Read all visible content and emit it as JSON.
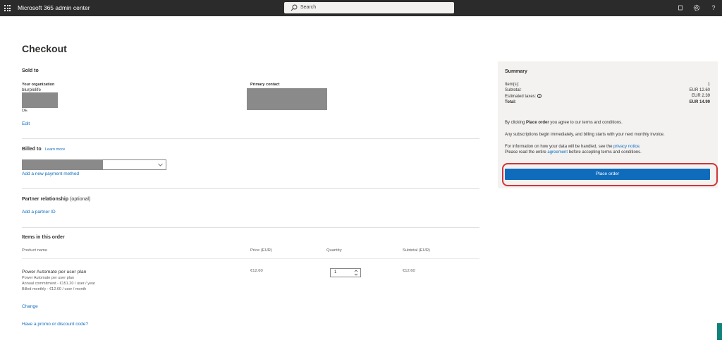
{
  "topbar": {
    "app_title": "Microsoft 365 admin center",
    "search_placeholder": "Search",
    "icons": [
      "waffle-icon",
      "search-icon",
      "dialog-icon",
      "settings-icon",
      "help-icon"
    ],
    "help_glyph": "?"
  },
  "page": {
    "title": "Checkout"
  },
  "sold_to": {
    "title": "Sold to",
    "org_label": "Your organization",
    "org_name": "blurplelife",
    "country": "DE",
    "primary_contact_label": "Primary contact",
    "edit_link": "Edit"
  },
  "billed_to": {
    "title": "Billed to",
    "learn_more": "Learn more",
    "add_payment": "Add a new payment method"
  },
  "partner": {
    "title": "Partner relationship",
    "optional": "(optional)",
    "add_partner": "Add a partner ID"
  },
  "items": {
    "title": "Items in this order",
    "columns": [
      "Product name",
      "Price (EUR)",
      "Quantity",
      "Subtotal (EUR)"
    ],
    "rows": [
      {
        "name": "Power Automate per user plan",
        "detail1": "Power Automate per user plan",
        "detail2": "Annual commitment - €151.20 / user / year",
        "detail3": "Billed monthly - €12.60 / user / month",
        "price": "€12.60",
        "quantity": "1",
        "subtotal": "€12.60"
      }
    ],
    "change_link": "Change",
    "promo_link": "Have a promo or discount code?"
  },
  "summary": {
    "title": "Summary",
    "items_label": "Item(s):",
    "items_value": "1",
    "subtotal_label": "Subtotal:",
    "subtotal_value": "EUR 12.60",
    "taxes_label": "Estimated taxes:",
    "taxes_value": "EUR 2.39",
    "total_label": "Total:",
    "total_value": "EUR 14.99",
    "terms_prefix": "By clicking ",
    "terms_bold": "Place order",
    "terms_suffix": " you agree to our terms and conditions.",
    "billing_note": "Any subscriptions begin immediately, and billing starts with your next monthly invoice.",
    "privacy_prefix": "For information on how your data will be handled, see the ",
    "privacy_link": "privacy notice",
    "privacy_suffix": ".",
    "agreement_prefix": "Please read the entire ",
    "agreement_link": "agreement",
    "agreement_suffix": " before accepting terms and conditions.",
    "place_order": "Place order"
  },
  "colors": {
    "topbar": "#2b2b2b",
    "accent": "#0f6cbd",
    "highlight": "#d13438",
    "panel": "#f3f2f1"
  }
}
